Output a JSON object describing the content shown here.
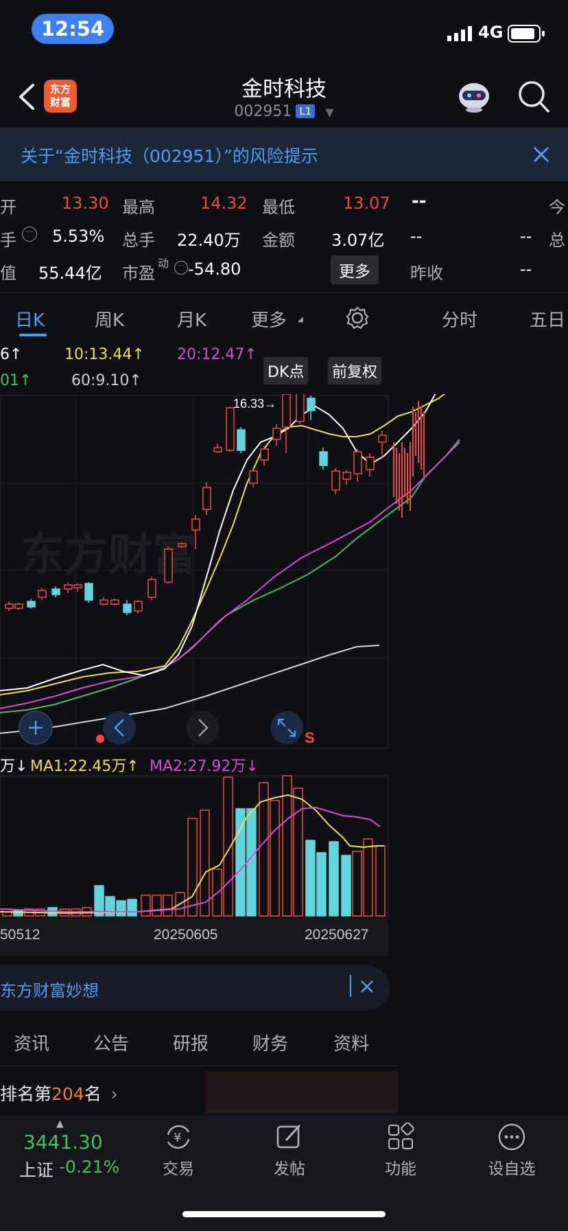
{
  "status": {
    "time": "12:54",
    "network": "4G"
  },
  "header": {
    "title": "金时科技",
    "code": "002951",
    "level_badge": "L1",
    "logo_text": "东方财富"
  },
  "risk_banner": {
    "text": "关于“金时科技（002951）”的风险提示"
  },
  "stats": {
    "row1": [
      {
        "label": "开",
        "value": "13.30"
      },
      {
        "label": "最高",
        "value": "14.32"
      },
      {
        "label": "最低",
        "value": "13.07"
      },
      {
        "label": "",
        "value": "--"
      },
      {
        "label": "今",
        "value": ""
      }
    ],
    "row2": [
      {
        "label": "手",
        "value": "5.53%"
      },
      {
        "label": "总手",
        "value": "22.40万"
      },
      {
        "label": "金额",
        "value": "3.07亿"
      },
      {
        "label": "",
        "value": "--"
      },
      {
        "label": "",
        "value": "--"
      },
      {
        "label": "总",
        "value": ""
      }
    ],
    "row3": [
      {
        "label": "值",
        "value": "55.44亿"
      },
      {
        "label": "市盈",
        "sup": "动",
        "value": "-54.80"
      },
      {
        "label": "",
        "value": "更多"
      },
      {
        "label": "昨收",
        "value": "--"
      }
    ]
  },
  "tabs": [
    "日K",
    "周K",
    "月K",
    "更多",
    "分时",
    "五日"
  ],
  "ma_legend": {
    "ma5": "6↑",
    "ma10": "10:13.44↑",
    "ma20": "20:12.47↑",
    "ma30": "01↑",
    "ma60": "60:9.10↑",
    "dk_label": "DK点",
    "fq_label": "前复权"
  },
  "chart_marks": {
    "high_label": "16.33→",
    "watermark": "东方财富",
    "s_mark": "S"
  },
  "volume_legend": {
    "vol": "万↓",
    "ma1": "MA1:22.45万↑",
    "ma2": "MA2:27.92万↓"
  },
  "date_labels": [
    "50512",
    "20250605",
    "20250627"
  ],
  "news": {
    "text": "东方财富妙想"
  },
  "info_tabs": [
    "资讯",
    "公告",
    "研报",
    "财务",
    "资料"
  ],
  "rank": {
    "prefix": "排名第",
    "num": "204",
    "suffix": "名"
  },
  "bottom_nav": {
    "index_value": "3441.30",
    "index_name": "上证",
    "index_change": "-0.21%",
    "items": [
      "交易",
      "发帖",
      "功能",
      "设自选"
    ]
  },
  "colors": {
    "up": "#f04b43",
    "down": "#5fd6dc",
    "accent": "#4f9cf2",
    "ma5": "#ffffff",
    "ma10": "#f2e04a",
    "ma20": "#d84ad8",
    "ma30": "#41c35a",
    "ma60": "#cfcfcf"
  }
}
